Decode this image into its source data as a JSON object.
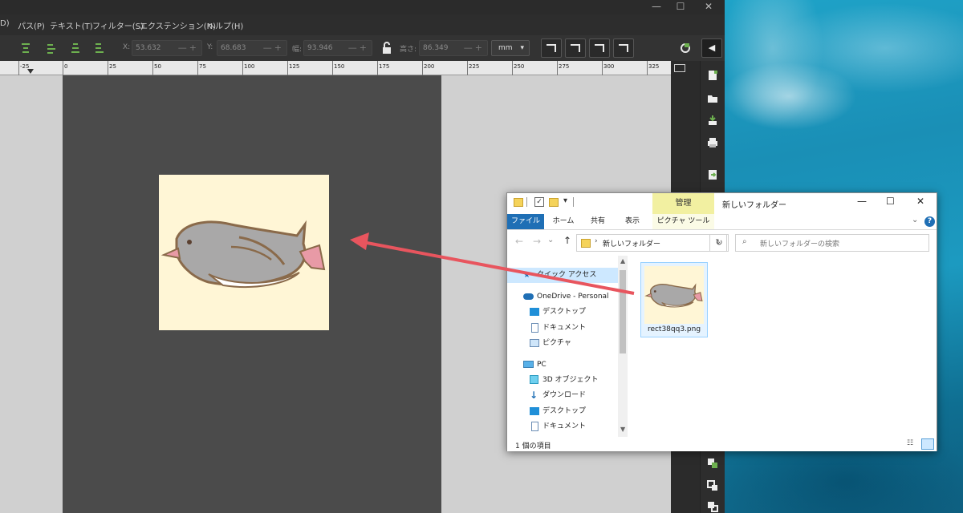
{
  "inkscape": {
    "window_controls": {
      "minimize": "—",
      "maximize": "☐",
      "close": "✕"
    },
    "menu": [
      "D)",
      "パス(P)",
      "テキスト(T)",
      "フィルター(S)",
      "エクステンション(N)",
      "ヘルプ(H)"
    ],
    "toolbar": {
      "x_label": "X:",
      "x_value": "53.632",
      "y_label": "Y:",
      "y_value": "68.683",
      "w_label": "幅:",
      "w_value": "93.946",
      "h_label": "高さ:",
      "h_value": "86.349",
      "units": "mm"
    },
    "ruler_labels": [
      "-25",
      "0",
      "25",
      "50",
      "75",
      "100",
      "125",
      "150",
      "175",
      "200",
      "225",
      "250",
      "275",
      "300",
      "325"
    ]
  },
  "explorer": {
    "title": "新しいフォルダー",
    "manage_tab": "管理",
    "tabs": [
      "ファイル",
      "ホーム",
      "共有",
      "表示",
      "ピクチャ ツール"
    ],
    "address": "新しいフォルダー",
    "search_placeholder": "新しいフォルダーの検索",
    "nav_items": [
      {
        "label": "クイック アクセス",
        "icon": "star-icon"
      },
      {
        "label": "OneDrive - Personal",
        "icon": "cloud-icon"
      },
      {
        "label": "デスクトップ",
        "icon": "desktop-icon"
      },
      {
        "label": "ドキュメント",
        "icon": "document-icon"
      },
      {
        "label": "ピクチャ",
        "icon": "picture-icon"
      },
      {
        "label": "PC",
        "icon": "computer-icon"
      },
      {
        "label": "3D オブジェクト",
        "icon": "cube-icon"
      },
      {
        "label": "ダウンロード",
        "icon": "download-icon"
      },
      {
        "label": "デスクトップ",
        "icon": "desktop-icon"
      },
      {
        "label": "ドキュメント",
        "icon": "document-icon"
      }
    ],
    "file": {
      "name": "rect38qq3.png"
    },
    "status": "1 個の項目"
  },
  "colors": {
    "accent": "#1f6fb5",
    "manage_tab": "#f2f0a1",
    "arrow": "#e8555e",
    "artboard": "#fff6d6"
  }
}
